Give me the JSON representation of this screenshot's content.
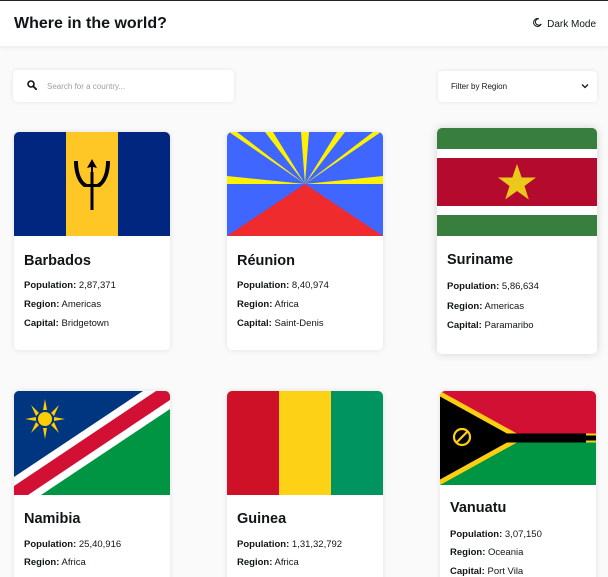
{
  "header": {
    "title": "Where in the world?",
    "dark_mode_label": "Dark Mode"
  },
  "search": {
    "placeholder": "Search for a country...",
    "value": ""
  },
  "filter": {
    "label": "Filter by Region"
  },
  "labels": {
    "population": "Population:",
    "region": "Region:",
    "capital": "Capital:"
  },
  "countries": [
    {
      "name": "Barbados",
      "population": "2,87,371",
      "region": "Americas",
      "capital": "Bridgetown"
    },
    {
      "name": "Réunion",
      "population": "8,40,974",
      "region": "Africa",
      "capital": "Saint-Denis"
    },
    {
      "name": "Suriname",
      "population": "5,86,634",
      "region": "Americas",
      "capital": "Paramaribo"
    },
    {
      "name": "Namibia",
      "population": "25,40,916",
      "region": "Africa",
      "capital": ""
    },
    {
      "name": "Guinea",
      "population": "1,31,32,792",
      "region": "Africa",
      "capital": ""
    },
    {
      "name": "Vanuatu",
      "population": "3,07,150",
      "region": "Oceania",
      "capital": "Port Vila"
    }
  ]
}
